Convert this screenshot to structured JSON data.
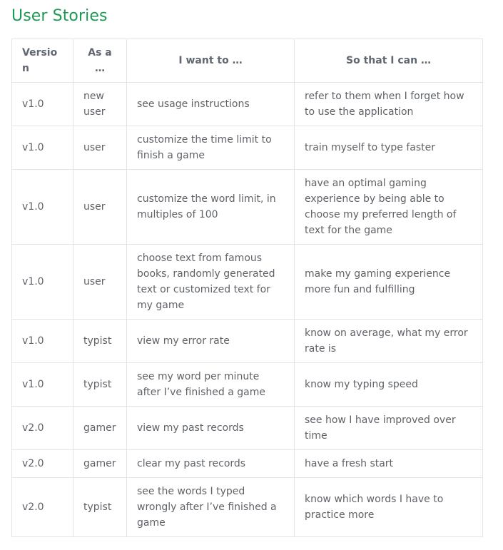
{
  "heading": "User Stories",
  "table": {
    "columns": [
      "Version",
      "As a …",
      "I want to …",
      "So that I can …"
    ],
    "rows": [
      {
        "version": "v1.0",
        "role": "new user",
        "want": "see usage instructions",
        "benefit": "refer to them when I forget how to use the application"
      },
      {
        "version": "v1.0",
        "role": "user",
        "want": "customize the time limit to finish a game",
        "benefit": "train myself to type faster"
      },
      {
        "version": "v1.0",
        "role": "user",
        "want": "customize the word limit, in multiples of 100",
        "benefit": "have an optimal gaming experience by being able to choose my preferred length of text for the game"
      },
      {
        "version": "v1.0",
        "role": "user",
        "want": "choose text from famous books, randomly generated text or customized text for my game",
        "benefit": "make my gaming experience more fun and fulfilling"
      },
      {
        "version": "v1.0",
        "role": "typist",
        "want": "view my error rate",
        "benefit": "know on average, what my error rate is"
      },
      {
        "version": "v1.0",
        "role": "typist",
        "want": "see my word per minute after I’ve finished a game",
        "benefit": "know my typing speed"
      },
      {
        "version": "v2.0",
        "role": "gamer",
        "want": "view my past records",
        "benefit": "see how I have improved over time"
      },
      {
        "version": "v2.0",
        "role": "gamer",
        "want": "clear my past records",
        "benefit": "have a fresh start"
      },
      {
        "version": "v2.0",
        "role": "typist",
        "want": "see the words I typed wrongly after I’ve finished a game",
        "benefit": "know which words I have to practice more"
      }
    ]
  }
}
